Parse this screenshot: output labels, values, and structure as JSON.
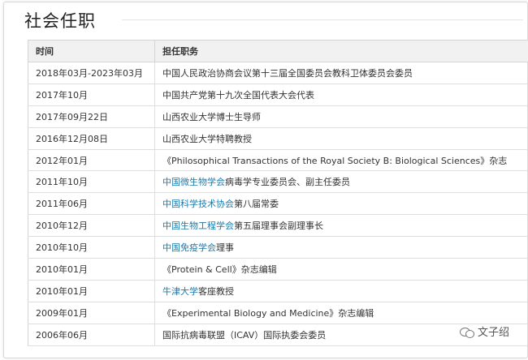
{
  "section": {
    "title": "社会任职"
  },
  "table": {
    "headers": [
      "时间",
      "担任职务"
    ],
    "rows": [
      {
        "date": "2018年03月-2023年03月",
        "parts": [
          {
            "text": "中国人民政治协商会议第十三届全国委员会教科卫体委员会委员",
            "link": false
          }
        ]
      },
      {
        "date": "2017年10月",
        "parts": [
          {
            "text": "中国共产党第十九次全国代表大会代表",
            "link": false
          }
        ]
      },
      {
        "date": "2017年09月22日",
        "parts": [
          {
            "text": "山西农业大学博士生导师",
            "link": false
          }
        ]
      },
      {
        "date": "2016年12月08日",
        "parts": [
          {
            "text": "山西农业大学特聘教授",
            "link": false
          }
        ]
      },
      {
        "date": "2012年01月",
        "parts": [
          {
            "text": "《Philosophical Transactions of the Royal Society B: Biological Sciences》杂志",
            "link": false
          }
        ]
      },
      {
        "date": "2011年10月",
        "parts": [
          {
            "text": "中国微生物学会",
            "link": true
          },
          {
            "text": "病毒学专业委员会、副主任委员",
            "link": false
          }
        ]
      },
      {
        "date": "2011年06月",
        "parts": [
          {
            "text": "中国科学技术协会",
            "link": true
          },
          {
            "text": "第八届常委",
            "link": false
          }
        ]
      },
      {
        "date": "2010年12月",
        "parts": [
          {
            "text": "中国生物工程学会",
            "link": true
          },
          {
            "text": "第五届理事会副理事长",
            "link": false
          }
        ]
      },
      {
        "date": "2010年10月",
        "parts": [
          {
            "text": "中国免疫学会",
            "link": true
          },
          {
            "text": "理事",
            "link": false
          }
        ]
      },
      {
        "date": "2010年01月",
        "parts": [
          {
            "text": "《Protein & Cell》杂志编辑",
            "link": false
          }
        ]
      },
      {
        "date": "2010年01月",
        "parts": [
          {
            "text": "牛津大学",
            "link": true
          },
          {
            "text": "客座教授",
            "link": false
          }
        ]
      },
      {
        "date": "2009年01月",
        "parts": [
          {
            "text": "《Experimental Biology and Medicine》杂志编辑",
            "link": false
          }
        ]
      },
      {
        "date": "2006年06月",
        "parts": [
          {
            "text": "国际抗病毒联盟（ICAV）国际执委会委员",
            "link": false
          }
        ]
      }
    ]
  },
  "watermark": {
    "text": "文子绍",
    "icon": "wechat-icon"
  },
  "colors": {
    "link": "#1e7aa8",
    "header_bg": "#f1f1f1",
    "border": "#dedede"
  }
}
